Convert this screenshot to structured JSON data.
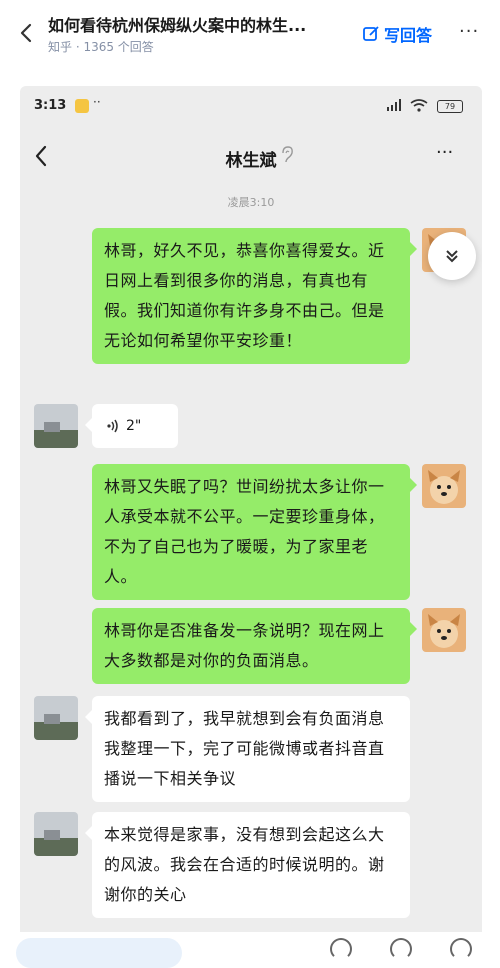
{
  "header": {
    "title": "如何看待杭州保姆纵火案中的林生...",
    "subtitle": "知乎 · 1365 个回答",
    "answer_label": "写回答",
    "more_label": "···"
  },
  "phone": {
    "time": "3:13",
    "status_dots": "··",
    "battery": "79"
  },
  "chat": {
    "name": "林生斌",
    "more_label": "···",
    "timestamp": "凌晨3:10",
    "voice_duration": "2\"",
    "messages": [
      {
        "side": "right",
        "text": "林哥，好久不见，恭喜你喜得爱女。近日网上看到很多你的消息，有真也有假。我们知道你有许多身不由己。但是无论如何希望你平安珍重！"
      },
      {
        "side": "left",
        "type": "voice"
      },
      {
        "side": "right",
        "text": "林哥又失眠了吗？世间纷扰太多让你一人承受本就不公平。一定要珍重身体，不为了自己也为了暖暖，为了家里老人。"
      },
      {
        "side": "right",
        "text": "林哥你是否准备发一条说明？现在网上大多数都是对你的负面消息。"
      },
      {
        "side": "left",
        "text": "我都看到了，我早就想到会有负面消息 我整理一下，完了可能微博或者抖音直播说一下相关争议"
      },
      {
        "side": "left",
        "text": "本来觉得是家事，没有想到会起这么大的风波。我会在合适的时候说明的。谢谢你的关心"
      }
    ]
  },
  "colors": {
    "accent": "#0066ff",
    "bubble_green": "#95ec69",
    "chat_bg": "#ededed"
  }
}
